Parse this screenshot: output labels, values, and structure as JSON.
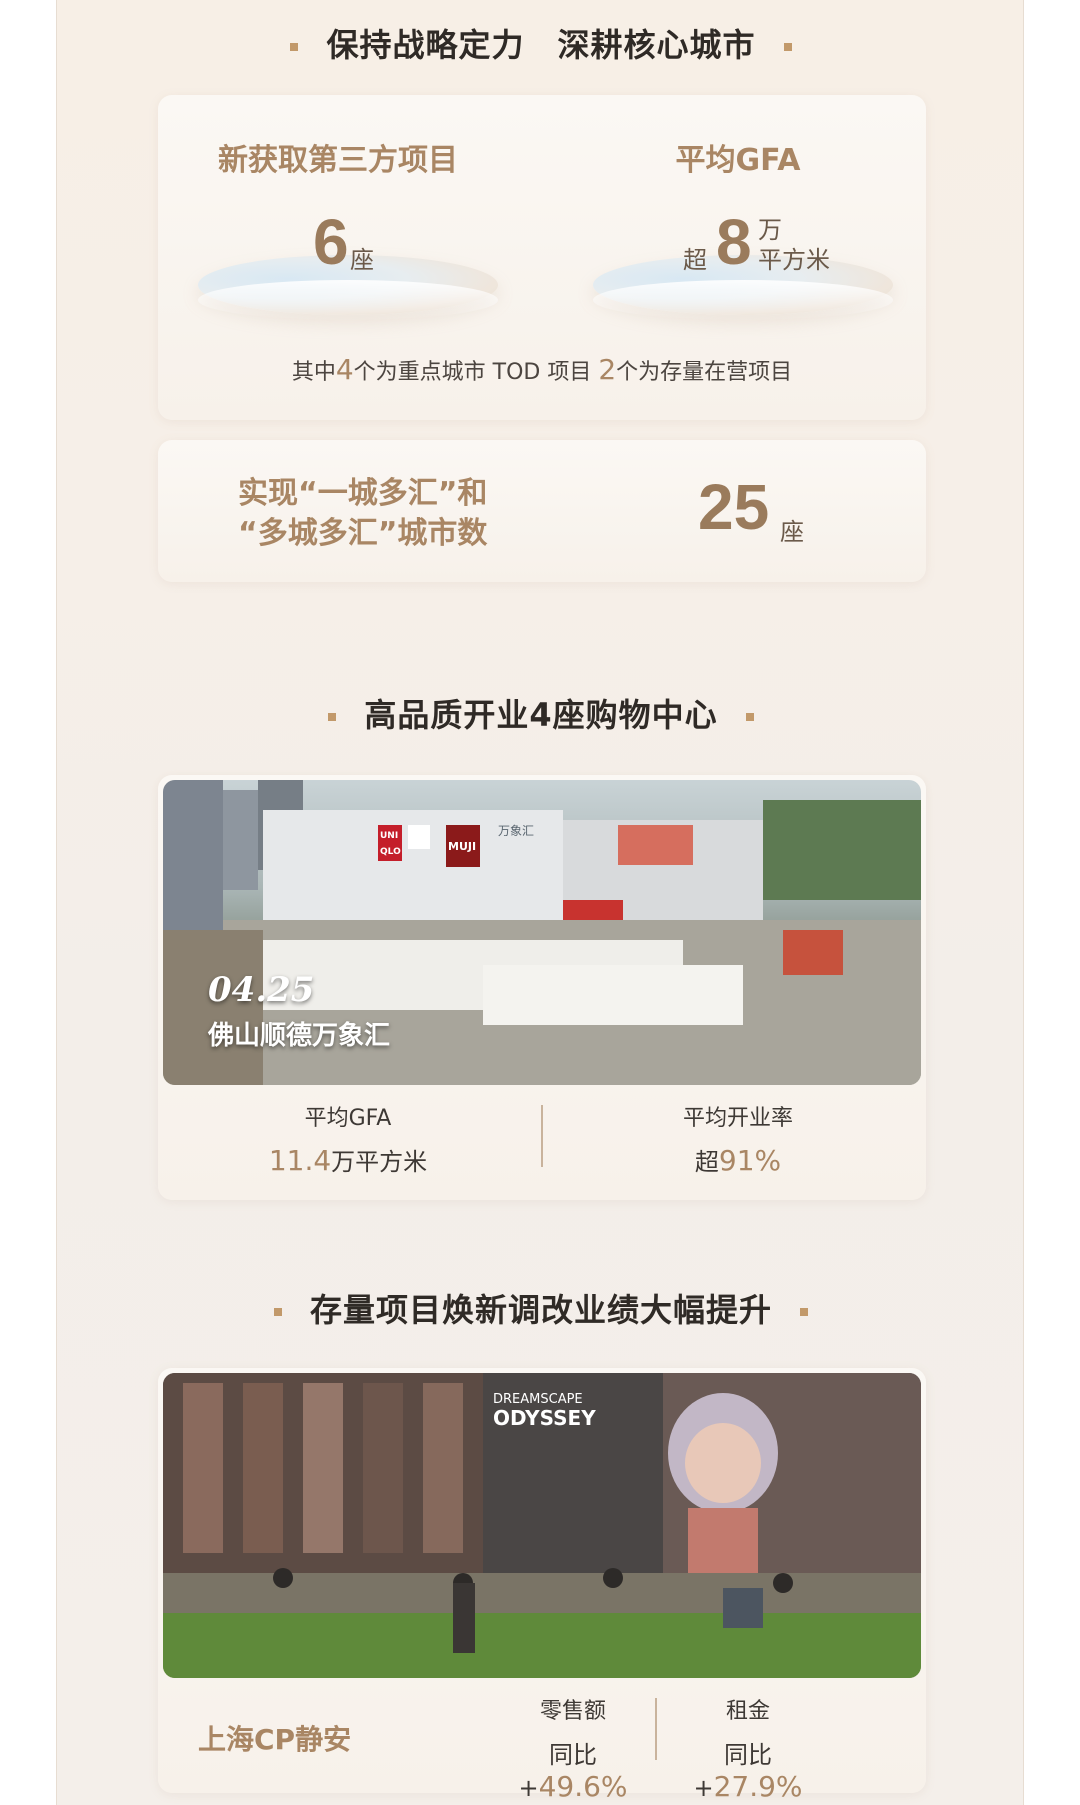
{
  "section1": {
    "title": "保持战略定力　深耕核心城市",
    "card1": {
      "left_label": "新获取第三方项目",
      "left_value": "6",
      "left_unit": "座",
      "right_label": "平均GFA",
      "right_prefix": "超",
      "right_value": "8",
      "right_unit_top": "万",
      "right_unit_bottom": "平方米",
      "note_pre": "其中",
      "note_num1": "4",
      "note_mid": "个为重点城市 TOD 项目 ",
      "note_num2": "2",
      "note_post": "个为存量在营项目"
    },
    "card2": {
      "label_line1": "实现“一城多汇”和",
      "label_line2": "“多城多汇”城市数",
      "value": "25",
      "unit": "座"
    }
  },
  "section2": {
    "title": "高品质开业4座购物中心",
    "photo_date": "04.25",
    "photo_caption": "佛山顺德万象汇",
    "signs": {
      "uniqlo_top": "UNI",
      "uniqlo_bottom": "QLO",
      "muji": "MUJI",
      "mall": "万象汇"
    },
    "stat_left_label": "平均GFA",
    "stat_left_num": "11.4",
    "stat_left_unit": "万平方米",
    "stat_right_label": "平均开业率",
    "stat_right_prefix": "超",
    "stat_right_num": "91%"
  },
  "section3": {
    "title": "存量项目焕新调改业绩大幅提升",
    "photo_signs": {
      "line1": "DREAMSCAPE",
      "line2": "ODYSSEY"
    },
    "project_name": "上海CP静安",
    "stat1_label": "零售额",
    "stat1_prefix": "同比 +",
    "stat1_num": "49.6%",
    "stat2_label": "租金",
    "stat2_prefix": "同比 +",
    "stat2_num": "27.9%"
  }
}
